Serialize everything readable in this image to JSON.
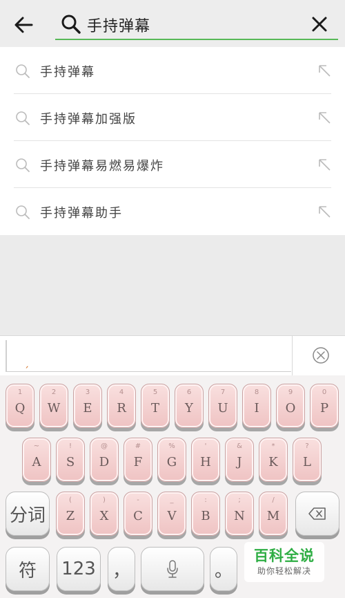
{
  "search": {
    "query": "手持弹幕"
  },
  "suggestions": [
    {
      "text": "手持弹幕"
    },
    {
      "text": "手持弹幕加强版"
    },
    {
      "text": "手持弹幕易燃易爆炸"
    },
    {
      "text": "手持弹幕助手"
    }
  ],
  "keyboard": {
    "row1": [
      {
        "num": "1",
        "letter": "Q"
      },
      {
        "num": "2",
        "letter": "W"
      },
      {
        "num": "3",
        "letter": "E"
      },
      {
        "num": "4",
        "letter": "R"
      },
      {
        "num": "5",
        "letter": "T"
      },
      {
        "num": "6",
        "letter": "Y"
      },
      {
        "num": "7",
        "letter": "U"
      },
      {
        "num": "8",
        "letter": "I"
      },
      {
        "num": "9",
        "letter": "O"
      },
      {
        "num": "0",
        "letter": "P"
      }
    ],
    "row2": [
      {
        "num": "~",
        "letter": "A"
      },
      {
        "num": "!",
        "letter": "S"
      },
      {
        "num": "@",
        "letter": "D"
      },
      {
        "num": "#",
        "letter": "F"
      },
      {
        "num": "%",
        "letter": "G"
      },
      {
        "num": "'",
        "letter": "H"
      },
      {
        "num": "&",
        "letter": "J"
      },
      {
        "num": "*",
        "letter": "K"
      },
      {
        "num": "?",
        "letter": "L"
      }
    ],
    "row3": [
      {
        "num": "(",
        "letter": "Z"
      },
      {
        "num": ")",
        "letter": "X"
      },
      {
        "num": "-",
        "letter": "C"
      },
      {
        "num": "_",
        "letter": "V"
      },
      {
        "num": ":",
        "letter": "B"
      },
      {
        "num": ";",
        "letter": "N"
      },
      {
        "num": "/",
        "letter": "M"
      }
    ],
    "fenci_label": "分词",
    "symbol_label": "符",
    "num_label": "123",
    "comma_label": "，",
    "period_label": "。"
  },
  "watermark": {
    "title": "百科全说",
    "subtitle": "助你轻松解决"
  },
  "colors": {
    "accent": "#57b957",
    "key_pink": "#f3d0cf",
    "watermark_green": "#2fae44"
  },
  "icons": {
    "back": "arrow-left-icon",
    "search": "search-icon",
    "clear": "close-icon",
    "fill": "arrow-up-left-icon",
    "delete": "backspace-icon",
    "mic": "microphone-icon",
    "candidate_close": "circle-x-icon"
  }
}
